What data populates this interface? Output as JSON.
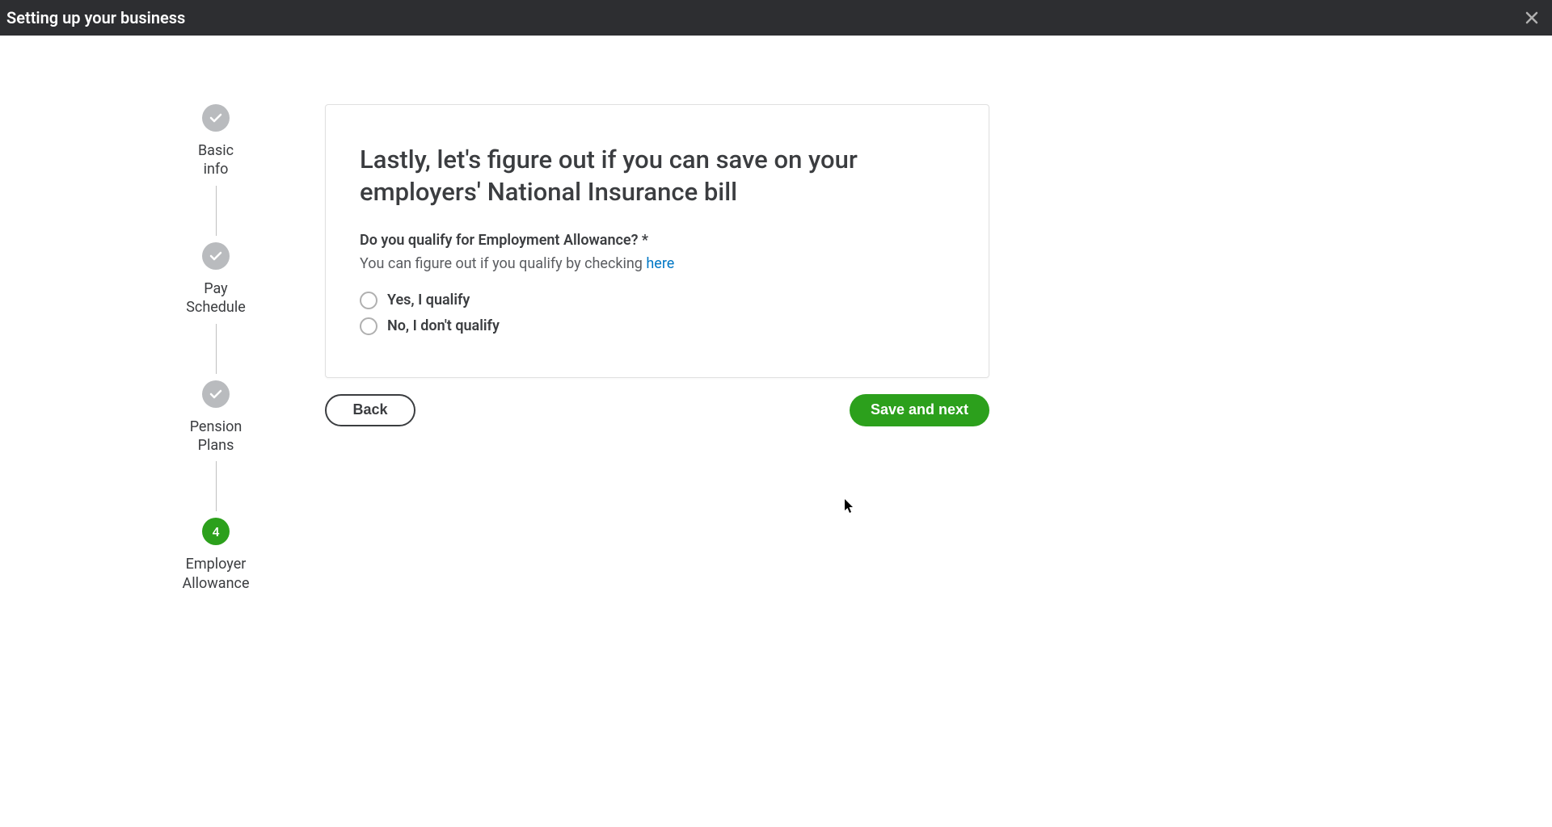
{
  "header": {
    "title": "Setting up your business"
  },
  "stepper": {
    "steps": [
      {
        "label": "Basic info",
        "state": "completed"
      },
      {
        "label": "Pay Schedule",
        "state": "completed"
      },
      {
        "label": "Pension Plans",
        "state": "completed"
      },
      {
        "label": "Employer Allowance",
        "state": "active",
        "number": "4"
      }
    ]
  },
  "card": {
    "title": "Lastly, let's figure out if you can save on your employers' National Insurance bill",
    "question": "Do you qualify for Employment Allowance? *",
    "helper_prefix": "You can figure out if you qualify by checking ",
    "helper_link": "here",
    "options": {
      "yes": "Yes, I qualify",
      "no": "No, I don't qualify"
    }
  },
  "buttons": {
    "back": "Back",
    "next": "Save and next"
  }
}
